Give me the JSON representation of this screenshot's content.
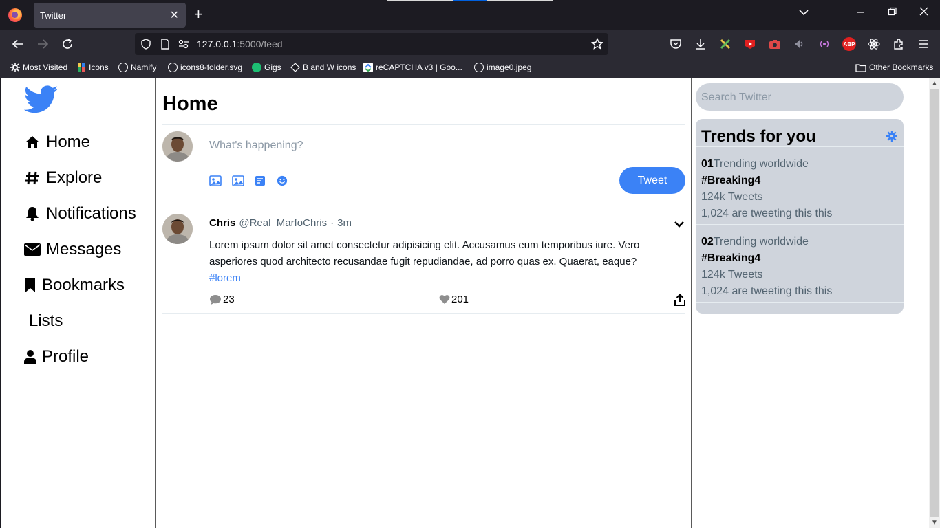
{
  "browser": {
    "tab_title": "Twitter",
    "url_host": "127.0.0.1",
    "url_path": ":5000/feed",
    "bookmarks": [
      {
        "label": "Most Visited",
        "icon": "gear-icon"
      },
      {
        "label": "Icons",
        "icon": "icons-site-icon"
      },
      {
        "label": "Namify",
        "icon": "globe-icon"
      },
      {
        "label": "icons8-folder.svg",
        "icon": "globe-icon"
      },
      {
        "label": "Gigs",
        "icon": "fiverr-icon"
      },
      {
        "label": "B and W icons",
        "icon": "bw-icons-icon"
      },
      {
        "label": "reCAPTCHA v3 | Goo...",
        "icon": "google-icon"
      },
      {
        "label": "image0.jpeg",
        "icon": "globe-icon"
      }
    ],
    "other_bookmarks": "Other Bookmarks",
    "extension_abp": "ABP"
  },
  "sidebar": {
    "items": [
      {
        "label": "Home",
        "icon": "home-icon"
      },
      {
        "label": "Explore",
        "icon": "hashtag-icon"
      },
      {
        "label": "Notifications",
        "icon": "bell-icon"
      },
      {
        "label": "Messages",
        "icon": "envelope-icon"
      },
      {
        "label": "Bookmarks",
        "icon": "bookmark-icon"
      },
      {
        "label": "Lists",
        "icon": ""
      },
      {
        "label": "Profile",
        "icon": "user-icon"
      }
    ]
  },
  "feed": {
    "title": "Home",
    "compose_placeholder": "What's happening?",
    "tweet_button": "Tweet",
    "tweet": {
      "name": "Chris",
      "handle": "@Real_MarfoChris",
      "separator": "·",
      "time": "3m",
      "text": "Lorem ipsum dolor sit amet consectetur adipisicing elit. Accusamus eum temporibus iure. Vero asperiores quod architecto recusandae fugit repudiandae, ad porro quas ex. Quaerat, eaque?",
      "hashtag": "#lorem",
      "replies": "23",
      "likes": "201"
    }
  },
  "right": {
    "search_placeholder": "Search Twitter",
    "trends_title": "Trends for you",
    "trends": [
      {
        "rank": "01",
        "context": "Trending worldwide",
        "tag": "#Breaking4",
        "tweets": "124k Tweets",
        "tweeting": "1,024 are tweeting this this"
      },
      {
        "rank": "02",
        "context": "Trending worldwide",
        "tag": "#Breaking4",
        "tweets": "124k Tweets",
        "tweeting": "1,024 are tweeting this this"
      }
    ]
  },
  "colors": {
    "accent": "#3b82f6",
    "panel": "#cfd4dc",
    "browser_dark": "#1c1b22",
    "browser_toolbar": "#2b2a33"
  }
}
